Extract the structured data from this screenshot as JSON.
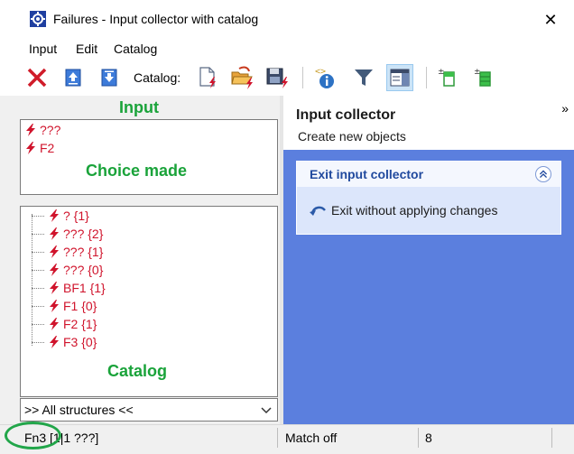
{
  "window": {
    "title": "Failures - Input collector with catalog",
    "close_glyph": "✕"
  },
  "menu": [
    "Input",
    "Edit",
    "Catalog"
  ],
  "toolbar": {
    "catalog_label": "Catalog:",
    "icons": [
      "delete-icon",
      "move-up-icon",
      "move-down-icon",
      "new-catalog-icon",
      "open-catalog-icon",
      "save-catalog-icon",
      "info-icon",
      "filter-icon",
      "catalog-view-icon",
      "add-above-icon",
      "add-below-icon"
    ]
  },
  "left": {
    "input_heading": "Input",
    "input_items": [
      "???",
      "F2"
    ],
    "choice_label": "Choice made",
    "catalog_items": [
      "? {1}",
      "??? {2}",
      "??? {1}",
      "??? {0}",
      "BF1 {1}",
      "F1 {0}",
      "F2 {1}",
      "F3 {0}"
    ],
    "catalog_label": "Catalog",
    "structure_select": ">> All structures <<"
  },
  "right": {
    "collapse_glyph": "»",
    "title": "Input collector",
    "subtitle": "Create new objects",
    "task_title": "Exit input collector",
    "task_link": "Exit without applying changes"
  },
  "status": {
    "left": "Fn3 [1|1 ???]",
    "middle": "Match off",
    "right": "8"
  },
  "colors": {
    "accent_green": "#1aa33a",
    "failure_red": "#d0142c",
    "task_pane_blue": "#5b7fde"
  }
}
